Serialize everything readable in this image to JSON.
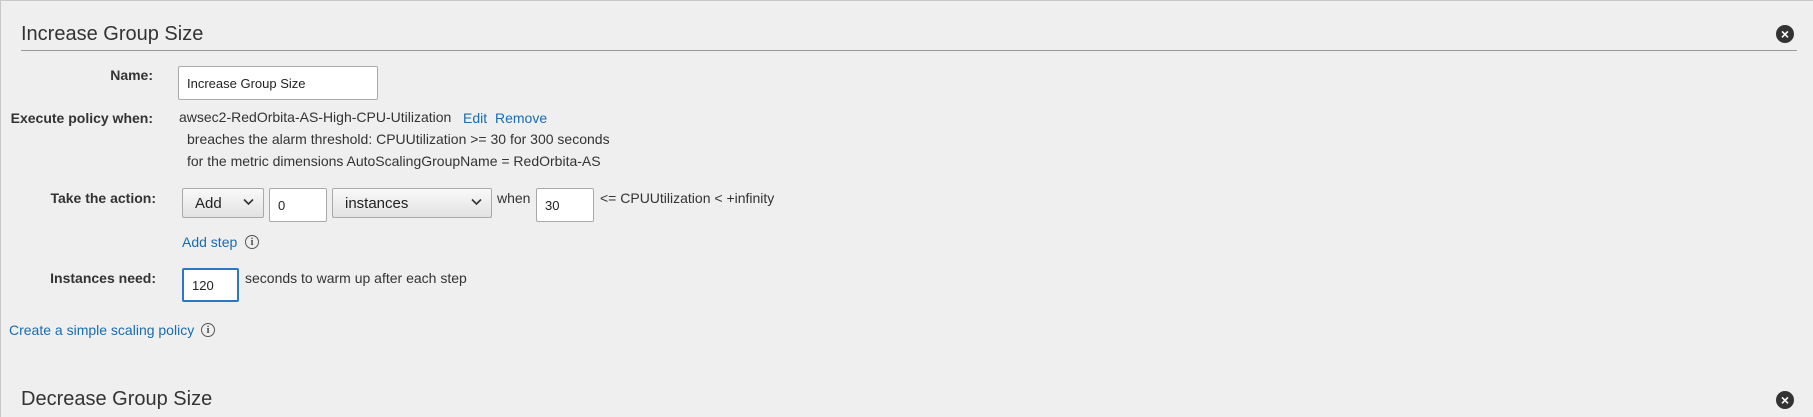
{
  "increase_section": {
    "title": "Increase Group Size",
    "name_label": "Name:",
    "name_value": "Increase Group Size",
    "execute_label": "Execute policy when:",
    "alarm_name": "awsec2-RedOrbita-AS-High-CPU-Utilization",
    "edit_link": "Edit",
    "remove_link": "Remove",
    "threshold_text": "breaches the alarm threshold: CPUUtilization >= 30 for 300 seconds",
    "dimensions_text": "for the metric dimensions AutoScalingGroupName = RedOrbita-AS",
    "take_action_label": "Take the action:",
    "action_select": "Add",
    "action_count": "0",
    "unit_select": "instances",
    "when_text": "when",
    "lower_bound": "30",
    "range_text": "<= CPUUtilization < +infinity",
    "add_step_link": "Add step",
    "instances_need_label": "Instances need:",
    "warmup_value": "120",
    "warmup_text": "seconds to warm up after each step",
    "create_simple_link": "Create a simple scaling policy"
  },
  "decrease_section": {
    "title": "Decrease Group Size"
  },
  "icons": {
    "close": "close-icon",
    "info": "info-icon",
    "chevron": "chevron-down-icon"
  }
}
